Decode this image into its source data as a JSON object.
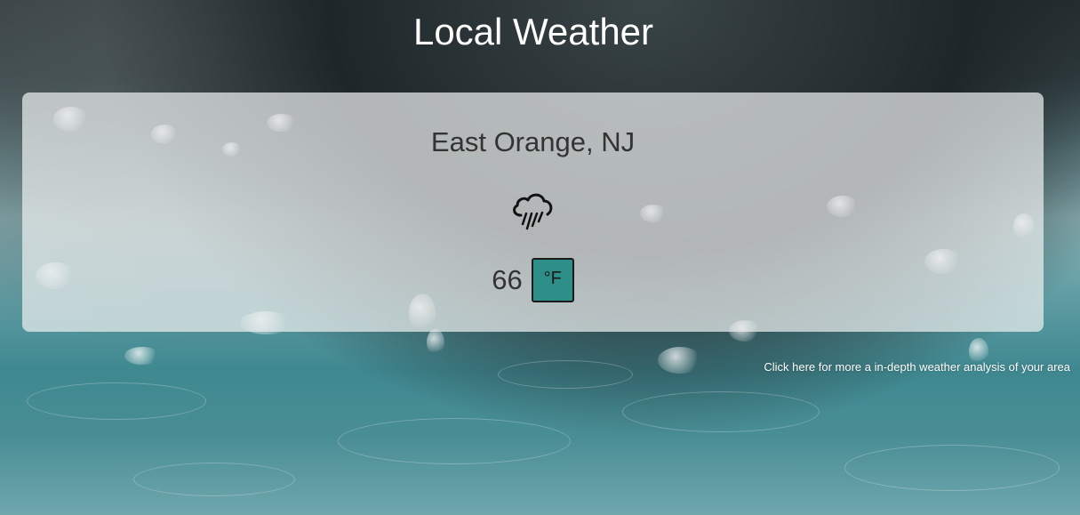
{
  "header": {
    "title": "Local Weather"
  },
  "weather": {
    "location": "East Orange, NJ",
    "icon": "rain-cloud-icon",
    "temperature": "66",
    "unit_label": "°F"
  },
  "footer": {
    "details_link": "Click here for more a in-depth weather analysis of your area"
  },
  "colors": {
    "unit_button_bg": "#2d8f88",
    "card_bg": "rgba(235,238,238,0.72)",
    "title_text": "#ffffff"
  }
}
